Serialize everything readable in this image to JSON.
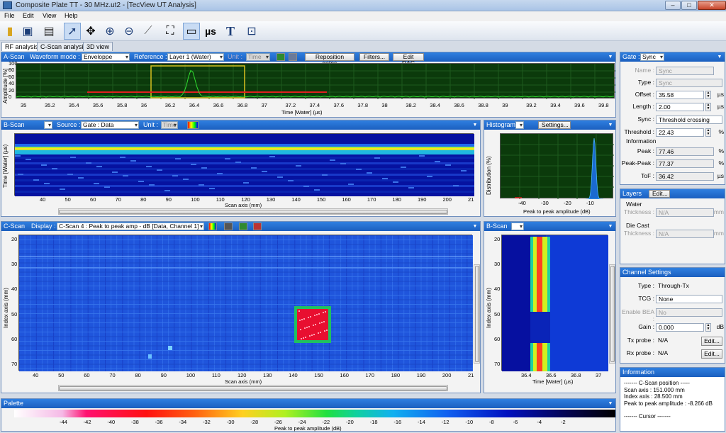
{
  "window": {
    "title": "Composite Plate TT - 30 MHz.ut2 - [TecView UT Analysis]"
  },
  "menu": [
    "File",
    "Edit",
    "View",
    "Help"
  ],
  "toolbar": {
    "units_label": "µs",
    "text_label": "T"
  },
  "tabs": [
    {
      "label": "RF analysis",
      "active": true
    },
    {
      "label": "C-Scan analysis"
    },
    {
      "label": "3D view"
    }
  ],
  "ascan": {
    "title": "A-Scan",
    "waveform_label": "Waveform mode :",
    "waveform_value": "Enveloppe",
    "reference_label": "Reference :",
    "reference_value": "Layer 1 (Water)",
    "unit_label": "Unit :",
    "unit_value": "Time",
    "reposition_button": "Reposition gates",
    "filters_button": "Filters...",
    "edit_dac_button": "Edit DAC",
    "ylabel": "Amplitude [%]",
    "yticks": [
      "100",
      "80",
      "60",
      "40",
      "20",
      "0"
    ],
    "xticks": [
      "35",
      "35.2",
      "35.4",
      "35.6",
      "35.8",
      "36",
      "36.2",
      "36.4",
      "36.6",
      "36.8",
      "37",
      "37.2",
      "37.4",
      "37.6",
      "37.8",
      "38",
      "38.2",
      "38.4",
      "38.6",
      "38.8",
      "39",
      "39.2",
      "39.4",
      "39.6",
      "39.8"
    ],
    "xlabel": "Time [Water] (µs)"
  },
  "bscan_top": {
    "title": "B-Scan",
    "source_label": "Source :",
    "source_value": "Gate : Data",
    "unit_label": "Unit :",
    "unit_value": "Time",
    "ylabel": "Time [Water] (µs)",
    "xticks": [
      "40",
      "50",
      "60",
      "70",
      "80",
      "90",
      "100",
      "110",
      "120",
      "130",
      "140",
      "150",
      "160",
      "170",
      "180",
      "190",
      "200",
      "21"
    ],
    "xlabel": "Scan axis (mm)"
  },
  "histogram": {
    "title": "Histogram",
    "settings_button": "Settings...",
    "ylabel": "Distribution (%)",
    "xticks": [
      "-40",
      "-30",
      "-20",
      "-10"
    ],
    "xlabel": "Peak to peak amplitude (dB)"
  },
  "cscan": {
    "title": "C-Scan",
    "display_label": "Display :",
    "display_value": "C-Scan 4 : Peak to peak amp - dB [Data, Channel 1]",
    "ylabel": "Index axis (mm)",
    "yticks": [
      "20",
      "30",
      "40",
      "50",
      "60",
      "70"
    ],
    "xticks": [
      "40",
      "50",
      "60",
      "70",
      "80",
      "90",
      "100",
      "110",
      "120",
      "130",
      "140",
      "150",
      "160",
      "170",
      "180",
      "190",
      "200",
      "21"
    ],
    "xlabel": "Scan axis (mm)"
  },
  "bscan_side": {
    "title": "B-Scan",
    "ylabel": "Index axis (mm)",
    "yticks": [
      "20",
      "30",
      "40",
      "50",
      "60",
      "70"
    ],
    "xticks": [
      "36.4",
      "36.6",
      "36.8",
      "37"
    ],
    "xlabel": "Time [Water] (µs)"
  },
  "palette": {
    "title": "Palette",
    "ticks": [
      "-44",
      "-42",
      "-40",
      "-38",
      "-36",
      "-34",
      "-32",
      "-30",
      "-28",
      "-26",
      "-24",
      "-22",
      "-20",
      "-18",
      "-16",
      "-14",
      "-12",
      "-10",
      "-8",
      "-6",
      "-4",
      "-2"
    ],
    "xlabel": "Peak to peak amplitude (dB)"
  },
  "gate": {
    "title": "Gate :",
    "value": "Sync",
    "name_label": "Name :",
    "name_value": "Sync",
    "type_label": "Type :",
    "type_value": "Sync",
    "offset_label": "Offset :",
    "offset_value": "35.58",
    "offset_unit": "µs",
    "length_label": "Length :",
    "length_value": "2.00",
    "length_unit": "µs",
    "sync_label": "Sync :",
    "sync_value": "Threshold crossing",
    "threshold_label": "Threshold :",
    "threshold_value": "22.43",
    "threshold_unit": "%",
    "information_label": "Information",
    "peak_label": "Peak :",
    "peak_value": "77.46",
    "peak_unit": "%",
    "pp_label": "Peak-Peak :",
    "pp_value": "77.37",
    "pp_unit": "%",
    "tof_label": "ToF :",
    "tof_value": "36.42",
    "tof_unit": "µs"
  },
  "layers": {
    "title": "Layers",
    "edit_button": "Edit...",
    "water_label": "Water",
    "water_thickness_label": "Thickness :",
    "water_thickness_value": "N/A",
    "water_unit": "mm",
    "diecast_label": "Die Cast",
    "diecast_thickness_label": "Thickness :",
    "diecast_thickness_value": "N/A",
    "diecast_unit": "mm"
  },
  "channel": {
    "title": "Channel Settings",
    "type_label": "Type :",
    "type_value": "Through-Tx",
    "tcg_label": "TCG :",
    "tcg_value": "None",
    "bea_label": "Enable BEA :",
    "bea_value": "No",
    "gain_label": "Gain :",
    "gain_value": "0.000",
    "gain_unit": "dB",
    "tx_label": "Tx probe :",
    "tx_value": "N/A",
    "tx_button": "Edit...",
    "rx_label": "Rx probe :",
    "rx_value": "N/A",
    "rx_button": "Edit..."
  },
  "information": {
    "title": "Information",
    "line1": "------- C-Scan position -----",
    "line2": "Scan axis : 151.000 mm",
    "line3": "Index axis : 28.500 mm",
    "line4": "Peak to peak amplitude : -8.266 dB",
    "line5": "------- Cursor -------"
  },
  "colors": {
    "header": "#1b5fbf",
    "background": "#d4dbe5"
  }
}
